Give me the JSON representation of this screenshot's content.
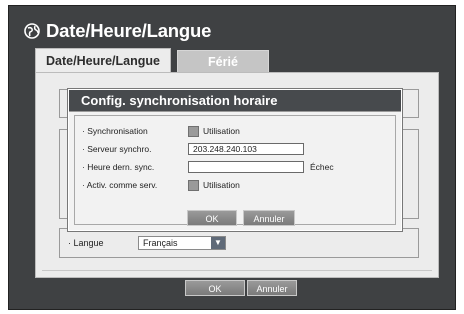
{
  "window": {
    "title": "Date/Heure/Langue",
    "icon": "globe-icon"
  },
  "tabs": [
    {
      "label": "Date/Heure/Langue",
      "active": true
    },
    {
      "label": "Férié",
      "active": false
    }
  ],
  "groups": {
    "language_label": "Langue",
    "language_value": "Français"
  },
  "footer": {
    "ok_label": "OK",
    "cancel_label": "Annuler"
  },
  "dialog": {
    "title": "Config. synchronisation horaire",
    "rows": {
      "sync_label": "· Synchronisation",
      "sync_option": "Utilisation",
      "server_label": "· Serveur synchro.",
      "server_value": "203.248.240.103",
      "last_sync_label": "· Heure dern. sync.",
      "last_sync_value": "",
      "last_sync_status": "Échec",
      "server_mode_label": "· Activ. comme serv.",
      "server_mode_option": "Utilisation"
    },
    "ok_label": "OK",
    "cancel_label": "Annuler"
  },
  "colors": {
    "frame": "#3f4143",
    "panel": "#ececec",
    "dialog_title": "#474a4d",
    "button": "#8a8a8a"
  }
}
